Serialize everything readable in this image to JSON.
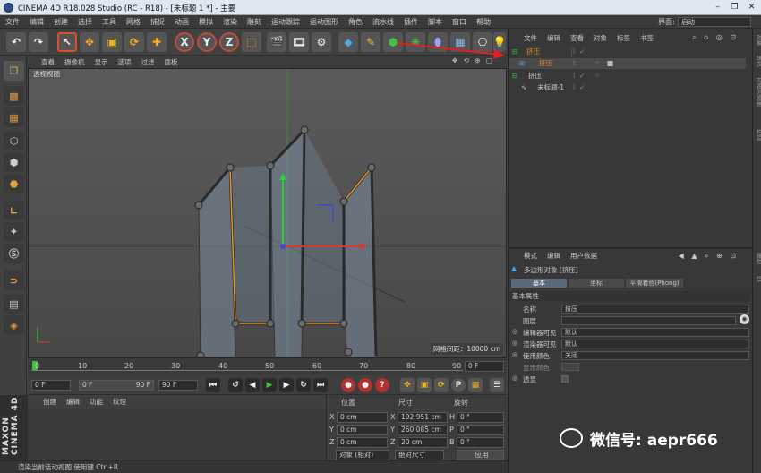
{
  "title": "CINEMA 4D R18.028 Studio (RC - R18) - [未标题 1 *] - 主要",
  "window_buttons": [
    "–",
    "❐",
    "✕"
  ],
  "menubar": {
    "items": [
      "文件",
      "编辑",
      "创建",
      "选择",
      "工具",
      "网格",
      "捕捉",
      "动画",
      "模拟",
      "渲染",
      "雕刻",
      "运动跟踪",
      "运动图形",
      "角色",
      "流水线",
      "插件",
      "脚本",
      "窗口",
      "帮助"
    ],
    "layout_label": "界面:",
    "layout_value": "启动"
  },
  "toolbar": {
    "x_label": "X",
    "y_label": "Y",
    "z_label": "Z"
  },
  "viewport": {
    "menu": [
      "查看",
      "摄像机",
      "显示",
      "选项",
      "过滤",
      "面板"
    ],
    "nav_icons": "✥ ⟲ ⊕ ▢",
    "label": "透视视图",
    "grid_label": "网格间距：10000 cm"
  },
  "timeline": {
    "ticks": [
      "0",
      "10",
      "20",
      "30",
      "40",
      "50",
      "60",
      "70",
      "80",
      "90"
    ],
    "current_frame": "0 F"
  },
  "transport": {
    "start": "0 F",
    "range_start": "0 F",
    "range_end": "90 F",
    "end": "90 F"
  },
  "materials": {
    "menu": [
      "创建",
      "编辑",
      "功能",
      "纹理"
    ]
  },
  "coords": {
    "headers": [
      "位置",
      "尺寸",
      "旋转"
    ],
    "rows": [
      {
        "axis": "X",
        "pos": "0 cm",
        "size_axis": "X",
        "size": "192.951 cm",
        "rot_axis": "H",
        "rot": "0 °"
      },
      {
        "axis": "Y",
        "pos": "0 cm",
        "size_axis": "Y",
        "size": "260.085 cm",
        "rot_axis": "P",
        "rot": "0 °"
      },
      {
        "axis": "Z",
        "pos": "0 cm",
        "size_axis": "Z",
        "size": "20 cm",
        "rot_axis": "B",
        "rot": "0 °"
      }
    ],
    "mode_left": "对象 (相对)",
    "mode_right": "绝对尺寸",
    "apply": "应用"
  },
  "status": "渲染当前活动视图 使用键 Ctrl+R",
  "maxon": "MAXON CINEMA 4D",
  "objects": {
    "menu": [
      "文件",
      "编辑",
      "查看",
      "对象",
      "标签",
      "书签"
    ],
    "rows": [
      {
        "name": "挤压",
        "indent": 0,
        "color": "#e08a2a"
      },
      {
        "name": "挤压",
        "indent": 1,
        "color": "#e08a2a"
      },
      {
        "name": "挤压",
        "indent": 0,
        "color": "#d0d0d0"
      },
      {
        "name": "未标题-1",
        "indent": 1,
        "color": "#d0d0d0"
      }
    ]
  },
  "attributes": {
    "menu": [
      "模式",
      "编辑",
      "用户数据"
    ],
    "object_title": "多边形对象 [挤压]",
    "tabs": [
      "基本",
      "坐标",
      "平滑着色(Phong)"
    ],
    "section": "基本属性",
    "fields": [
      {
        "label": "名称",
        "value": "挤压"
      },
      {
        "label": "图层",
        "value": ""
      },
      {
        "label": "编辑器可见",
        "value": "默认"
      },
      {
        "label": "渲染器可见",
        "value": "默认"
      },
      {
        "label": "使用颜色",
        "value": "关闭"
      },
      {
        "label": "显示颜色",
        "value": ""
      },
      {
        "label": "透显",
        "value": ""
      }
    ]
  },
  "right_strip": [
    "对象",
    "场次",
    "内容浏览器",
    "构造",
    "属性",
    "层"
  ],
  "watermark": "微信号: aepr666"
}
